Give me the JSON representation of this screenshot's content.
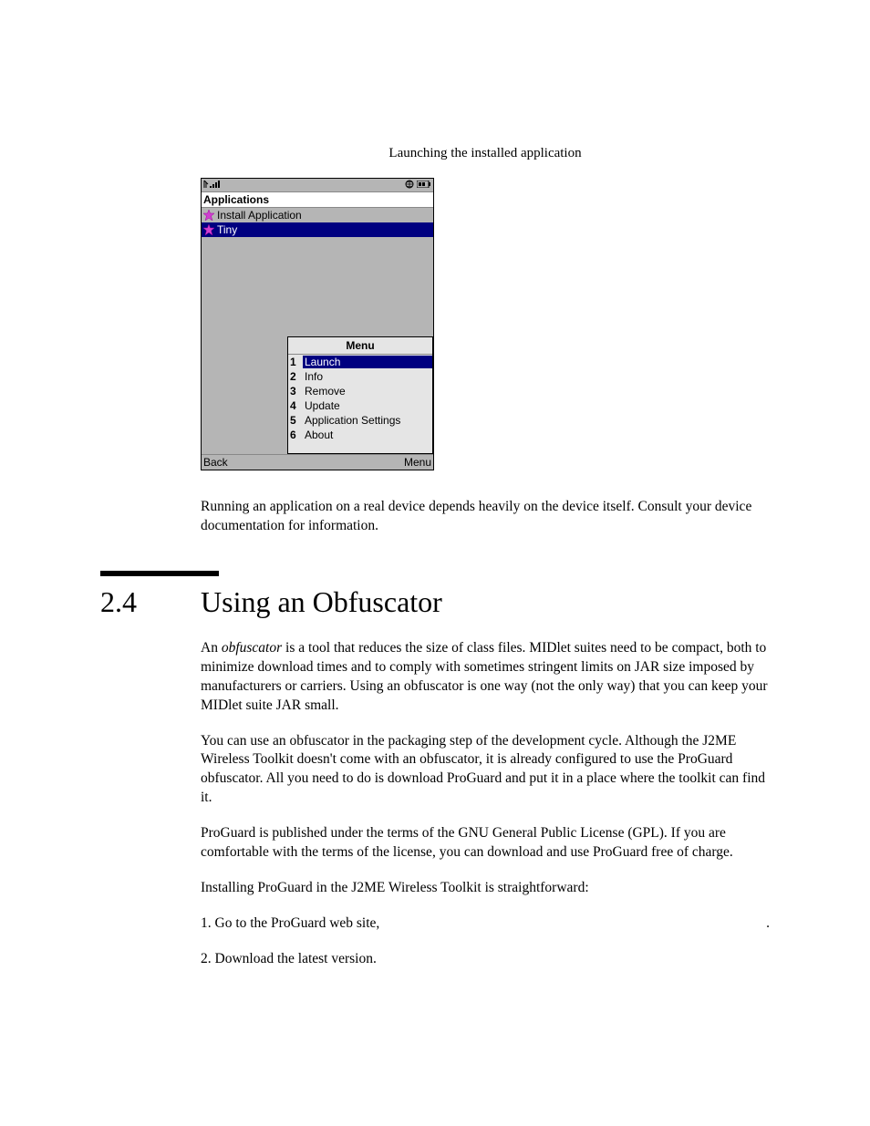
{
  "caption": "Launching the installed application",
  "phone": {
    "title": "Applications",
    "list": [
      {
        "label": "Install Application",
        "selected": false
      },
      {
        "label": "Tiny",
        "selected": true
      }
    ],
    "menu_title": "Menu",
    "menu": [
      {
        "n": "1",
        "label": "Launch",
        "selected": true
      },
      {
        "n": "2",
        "label": "Info",
        "selected": false
      },
      {
        "n": "3",
        "label": "Remove",
        "selected": false
      },
      {
        "n": "4",
        "label": "Update",
        "selected": false
      },
      {
        "n": "5",
        "label": "Application Settings",
        "selected": false
      },
      {
        "n": "6",
        "label": "About",
        "selected": false
      }
    ],
    "soft_left": "Back",
    "soft_right": "Menu"
  },
  "para1": "Running an application on a real device depends heavily on the device itself. Consult your device documentation for information.",
  "section": {
    "num": "2.4",
    "title": "Using an Obfuscator"
  },
  "para2a": "An ",
  "para2b": "obfuscator",
  "para2c": " is a tool that reduces the size of class files. MIDlet suites need to be compact, both to minimize download times and to comply with sometimes stringent limits on JAR size imposed by manufacturers or carriers. Using an obfuscator is one way (not the only way) that you can keep your MIDlet suite JAR small.",
  "para3": "You can use an obfuscator in the packaging step of the development cycle. Although the J2ME Wireless Toolkit doesn't come with an obfuscator, it is already configured to use the ProGuard obfuscator. All you need to do is download ProGuard and put it in a place where the toolkit can find it.",
  "para4": "ProGuard is published under the terms of the GNU General Public License (GPL). If you are comfortable with the terms of the license, you can download and use ProGuard free of charge.",
  "para5": "Installing ProGuard in the J2ME Wireless Toolkit is straightforward:",
  "step1": "1.  Go to the ProGuard web site,",
  "step1_end": ".",
  "step2": "2.  Download the latest version."
}
